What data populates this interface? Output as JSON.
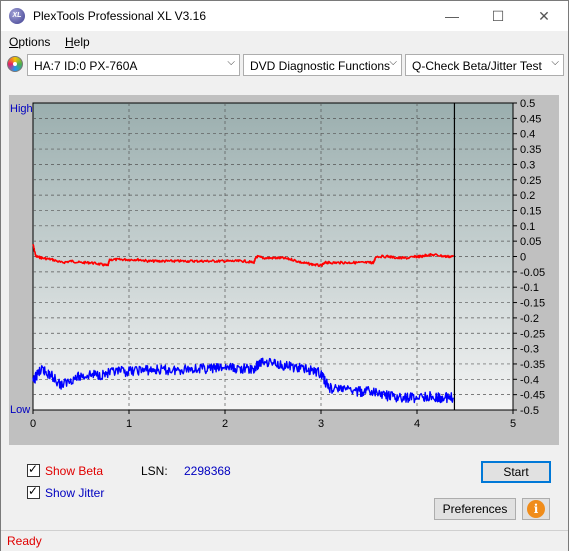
{
  "window": {
    "title": "PlexTools Professional XL V3.16",
    "icon_text": "XL",
    "minimize": "—",
    "maximize": "☐",
    "close": "✕"
  },
  "menu": [
    {
      "label": "Options",
      "mnemonic": "O",
      "rest": "ptions"
    },
    {
      "label": "Help",
      "mnemonic": "H",
      "rest": "elp"
    }
  ],
  "toolbar": {
    "drive": "HA:7 ID:0  PX-760A",
    "function": "DVD Diagnostic Functions",
    "test": "Q-Check Beta/Jitter Test",
    "arrow": "⌵"
  },
  "chart_data": {
    "type": "line",
    "left_axis_labels": {
      "top": "High",
      "bottom": "Low"
    },
    "x_ticks": [
      "0",
      "1",
      "2",
      "3",
      "4",
      "5"
    ],
    "y_ticks": [
      "0.5",
      "0.45",
      "0.4",
      "0.35",
      "0.3",
      "0.25",
      "0.2",
      "0.15",
      "0.1",
      "0.05",
      "0",
      "-0.05",
      "-0.1",
      "-0.15",
      "-0.2",
      "-0.25",
      "-0.3",
      "-0.35",
      "-0.4",
      "-0.45",
      "-0.5"
    ],
    "xlim": [
      0,
      5
    ],
    "ylim": [
      -0.5,
      0.5
    ],
    "end_marker_x": 4.39,
    "series": [
      {
        "name": "Beta",
        "color": "#ff0000",
        "points": [
          [
            0.0,
            0.04
          ],
          [
            0.03,
            0.0
          ],
          [
            0.1,
            -0.005
          ],
          [
            0.2,
            -0.01
          ],
          [
            0.3,
            -0.02
          ],
          [
            0.4,
            -0.015
          ],
          [
            0.5,
            -0.02
          ],
          [
            0.6,
            -0.02
          ],
          [
            0.7,
            -0.025
          ],
          [
            0.78,
            -0.03
          ],
          [
            0.8,
            -0.01
          ],
          [
            0.9,
            -0.01
          ],
          [
            1.0,
            -0.01
          ],
          [
            1.1,
            -0.01
          ],
          [
            1.2,
            -0.015
          ],
          [
            1.3,
            -0.015
          ],
          [
            1.4,
            -0.015
          ],
          [
            1.5,
            -0.015
          ],
          [
            1.6,
            -0.015
          ],
          [
            1.7,
            -0.015
          ],
          [
            1.8,
            -0.015
          ],
          [
            1.9,
            -0.015
          ],
          [
            2.0,
            -0.015
          ],
          [
            2.1,
            -0.015
          ],
          [
            2.2,
            -0.015
          ],
          [
            2.3,
            -0.02
          ],
          [
            2.33,
            0.0
          ],
          [
            2.4,
            -0.005
          ],
          [
            2.5,
            -0.005
          ],
          [
            2.6,
            -0.005
          ],
          [
            2.7,
            -0.01
          ],
          [
            2.8,
            -0.02
          ],
          [
            2.9,
            -0.025
          ],
          [
            3.0,
            -0.03
          ],
          [
            3.05,
            -0.02
          ],
          [
            3.1,
            -0.02
          ],
          [
            3.2,
            -0.02
          ],
          [
            3.3,
            -0.02
          ],
          [
            3.4,
            -0.02
          ],
          [
            3.5,
            -0.02
          ],
          [
            3.55,
            -0.02
          ],
          [
            3.57,
            0.0
          ],
          [
            3.7,
            0.0
          ],
          [
            3.8,
            -0.005
          ],
          [
            3.9,
            -0.005
          ],
          [
            4.0,
            0.0
          ],
          [
            4.05,
            0.0
          ],
          [
            4.1,
            0.005
          ],
          [
            4.2,
            0.005
          ],
          [
            4.3,
            0.0
          ],
          [
            4.38,
            0.0
          ]
        ]
      },
      {
        "name": "Jitter",
        "color": "#0000ff",
        "points": [
          [
            0.0,
            -0.41
          ],
          [
            0.05,
            -0.38
          ],
          [
            0.1,
            -0.37
          ],
          [
            0.15,
            -0.38
          ],
          [
            0.2,
            -0.39
          ],
          [
            0.3,
            -0.42
          ],
          [
            0.4,
            -0.4
          ],
          [
            0.5,
            -0.39
          ],
          [
            0.6,
            -0.385
          ],
          [
            0.7,
            -0.385
          ],
          [
            0.8,
            -0.38
          ],
          [
            0.9,
            -0.375
          ],
          [
            1.0,
            -0.375
          ],
          [
            1.1,
            -0.37
          ],
          [
            1.2,
            -0.37
          ],
          [
            1.3,
            -0.37
          ],
          [
            1.4,
            -0.37
          ],
          [
            1.5,
            -0.37
          ],
          [
            1.6,
            -0.365
          ],
          [
            1.7,
            -0.365
          ],
          [
            1.8,
            -0.365
          ],
          [
            1.9,
            -0.365
          ],
          [
            2.0,
            -0.36
          ],
          [
            2.1,
            -0.365
          ],
          [
            2.2,
            -0.365
          ],
          [
            2.3,
            -0.37
          ],
          [
            2.35,
            -0.35
          ],
          [
            2.4,
            -0.34
          ],
          [
            2.5,
            -0.345
          ],
          [
            2.6,
            -0.355
          ],
          [
            2.7,
            -0.36
          ],
          [
            2.8,
            -0.365
          ],
          [
            2.9,
            -0.37
          ],
          [
            3.0,
            -0.38
          ],
          [
            3.05,
            -0.41
          ],
          [
            3.1,
            -0.43
          ],
          [
            3.2,
            -0.43
          ],
          [
            3.3,
            -0.435
          ],
          [
            3.4,
            -0.44
          ],
          [
            3.5,
            -0.44
          ],
          [
            3.6,
            -0.445
          ],
          [
            3.7,
            -0.455
          ],
          [
            3.8,
            -0.46
          ],
          [
            3.9,
            -0.46
          ],
          [
            4.0,
            -0.46
          ],
          [
            4.1,
            -0.455
          ],
          [
            4.2,
            -0.46
          ],
          [
            4.3,
            -0.46
          ],
          [
            4.38,
            -0.46
          ]
        ]
      }
    ]
  },
  "options": {
    "show_beta": {
      "label": "Show Beta",
      "checked": true
    },
    "show_jitter": {
      "label": "Show Jitter",
      "checked": true
    },
    "lsn_label": "LSN:",
    "lsn_value": "2298368"
  },
  "buttons": {
    "start": "Start",
    "preferences": "Preferences",
    "info": "i"
  },
  "status": {
    "text": "Ready"
  },
  "colors": {
    "plot_top": "#9aaeae",
    "plot_bottom": "#f4f4f4",
    "beta": "#ff0000",
    "jitter": "#0000ff",
    "status_text": "#e00000",
    "label_blue": "#0000c0"
  }
}
